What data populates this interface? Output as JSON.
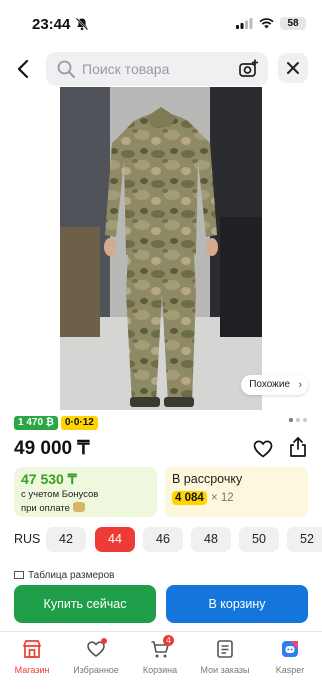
{
  "status_bar": {
    "time": "23:44",
    "battery": "58"
  },
  "search": {
    "placeholder": "Поиск товара"
  },
  "gallery": {
    "similar_label": "Похожие"
  },
  "badges": {
    "rating_badge": "1 470 ₿",
    "installment_badge": "0·0·12"
  },
  "product": {
    "price": "49 000 ₸"
  },
  "bonus": {
    "price": "47 530 ₸",
    "line1": "с учетом Бонусов",
    "line2": "при оплате"
  },
  "installment": {
    "title": "В рассрочку",
    "amount": "4 084",
    "multiplier": "× 12"
  },
  "sizes": {
    "system": "RUS",
    "options": [
      "42",
      "44",
      "46",
      "48",
      "50",
      "52"
    ],
    "selected": "44"
  },
  "size_table": {
    "label": "Таблица размеров"
  },
  "actions": {
    "buy_now": "Купить сейчас",
    "add_to_cart": "В корзину"
  },
  "tabbar": {
    "items": [
      {
        "label": "Магазин",
        "icon": "shop-icon"
      },
      {
        "label": "Избранное",
        "icon": "heart-icon"
      },
      {
        "label": "Корзина",
        "icon": "cart-icon"
      },
      {
        "label": "Мои заказы",
        "icon": "orders-icon"
      },
      {
        "label": "Kasper",
        "icon": "kasper-icon"
      }
    ],
    "cart_count": "4"
  },
  "colors": {
    "accent_red": "#ee3b35",
    "buy_green": "#1f9e49",
    "cart_blue": "#1476db",
    "bonus_green": "#3a9d23",
    "highlight_yellow": "#ffd400"
  }
}
